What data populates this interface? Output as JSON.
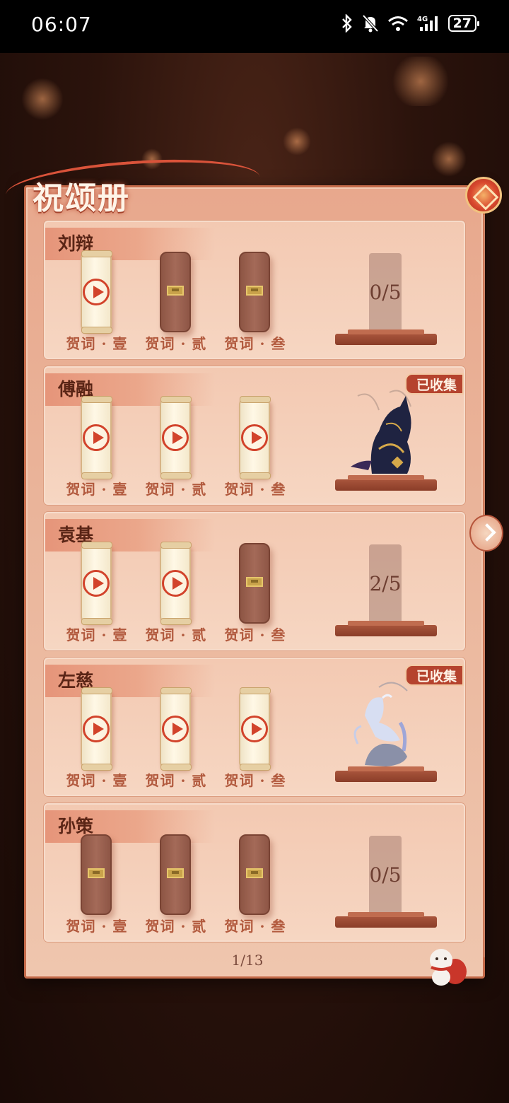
{
  "status_bar": {
    "time": "06:07",
    "battery": "27"
  },
  "book": {
    "title": "祝颂册"
  },
  "scroll_labels": [
    "贺词 · 壹",
    "贺词 · 贰",
    "贺词 · 叁"
  ],
  "characters": [
    {
      "name": "刘辩",
      "scrolls": [
        "locked_open",
        "locked",
        "locked"
      ],
      "scroll_states": [
        "open",
        "locked",
        "locked"
      ],
      "progress": "0/5",
      "collected": ""
    },
    {
      "name": "傅融",
      "scroll_states": [
        "open",
        "open",
        "open"
      ],
      "progress": "",
      "collected": "已收集"
    },
    {
      "name": "袁基",
      "scroll_states": [
        "open",
        "open",
        "locked"
      ],
      "progress": "2/5",
      "collected": ""
    },
    {
      "name": "左慈",
      "scroll_states": [
        "open",
        "open",
        "open"
      ],
      "progress": "",
      "collected": "已收集"
    },
    {
      "name": "孙策",
      "scroll_states": [
        "locked",
        "locked",
        "locked"
      ],
      "progress": "0/5",
      "collected": ""
    }
  ],
  "pagination": {
    "label": "1/13"
  },
  "icons": {
    "play": "play-icon",
    "lock": "lock-icon",
    "next": "chevron-right-icon"
  },
  "colors": {
    "accent": "#d2432b",
    "panel": "#eab49a",
    "locked_scroll": "#a46a58"
  }
}
